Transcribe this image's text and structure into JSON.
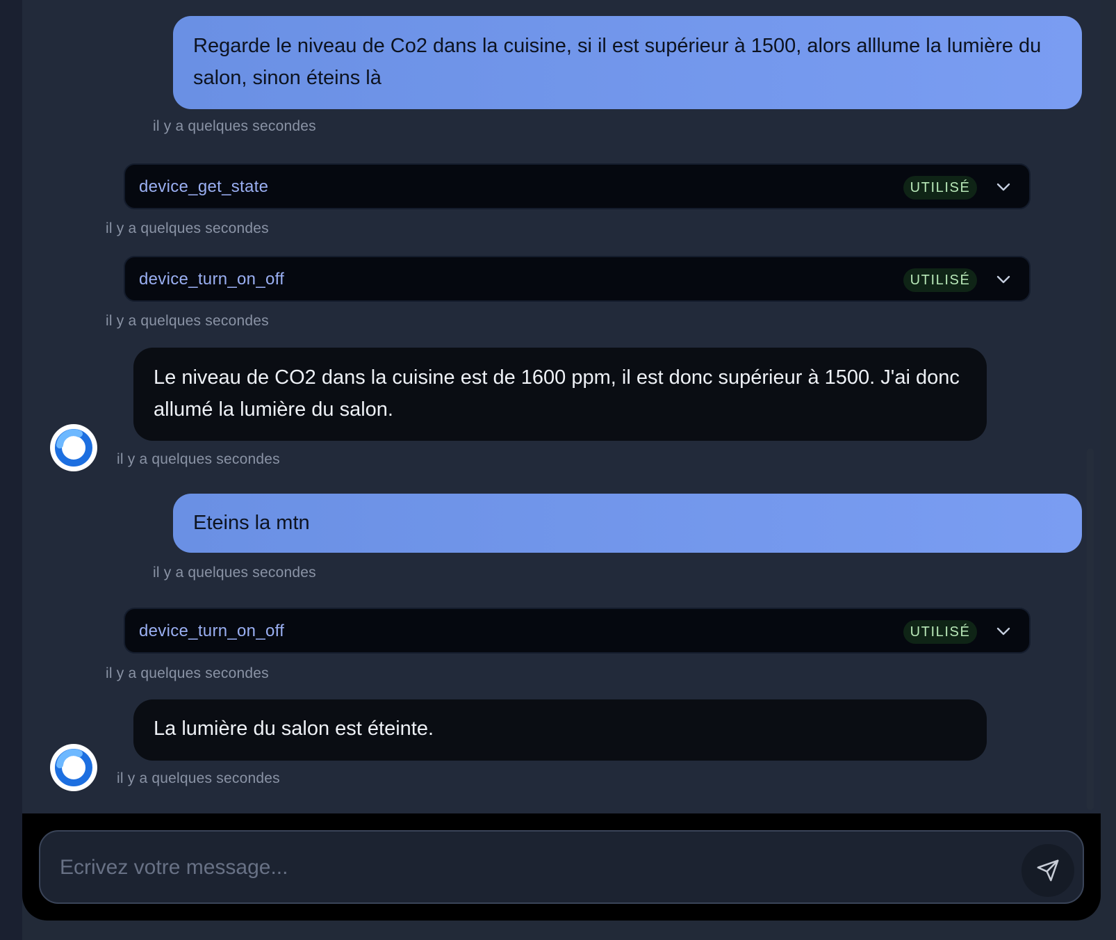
{
  "messages": [
    {
      "role": "user",
      "text": "Regarde le niveau de Co2 dans la cuisine, si il est supérieur à 1500, alors alllume la lumière du salon, sinon éteins là",
      "time": "il y a quelques secondes"
    },
    {
      "role": "tool",
      "name": "device_get_state",
      "status": "UTILISÉ",
      "time": "il y a quelques secondes"
    },
    {
      "role": "tool",
      "name": "device_turn_on_off",
      "status": "UTILISÉ",
      "time": "il y a quelques secondes"
    },
    {
      "role": "assistant",
      "text": "Le niveau de CO2 dans la cuisine est de 1600 ppm, il est donc supérieur à 1500. J'ai donc allumé la lumière du salon.",
      "time": "il y a quelques secondes"
    },
    {
      "role": "user",
      "text": "Eteins la mtn",
      "time": "il y a quelques secondes"
    },
    {
      "role": "tool",
      "name": "device_turn_on_off",
      "status": "UTILISÉ",
      "time": "il y a quelques secondes"
    },
    {
      "role": "assistant",
      "text": "La lumière du salon est éteinte.",
      "time": "il y a quelques secondes"
    }
  ],
  "composer": {
    "placeholder": "Ecrivez votre message...",
    "value": "",
    "send_icon": "send-icon"
  },
  "icons": {
    "tool_expand": "chevron-down-icon",
    "assistant_avatar": "assistant-logo-icon"
  },
  "colors": {
    "user_bubble": "#7a9df2",
    "assistant_bubble": "#0a0d13",
    "tool_name": "#9aaff2",
    "status_badge_bg": "#0f2416",
    "status_badge_text": "#b8e8b8",
    "background": "#222a3a"
  }
}
